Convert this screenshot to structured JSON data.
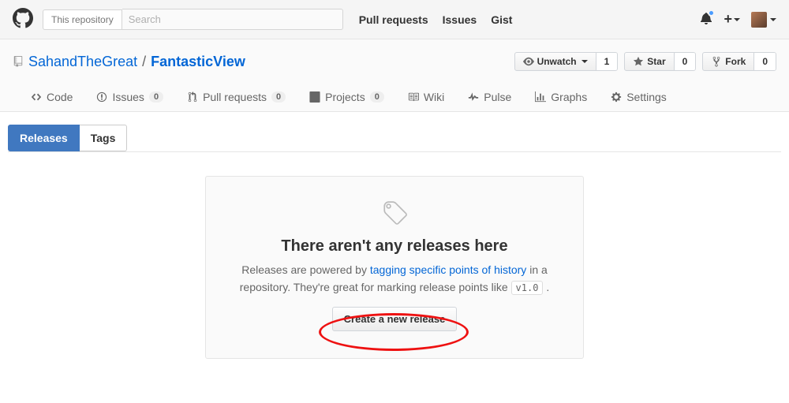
{
  "topbar": {
    "scope": "This repository",
    "search_placeholder": "Search",
    "nav": {
      "pulls": "Pull requests",
      "issues": "Issues",
      "gist": "Gist"
    }
  },
  "repo": {
    "owner": "SahandTheGreat",
    "sep": "/",
    "name": "FantasticView",
    "actions": {
      "watch": {
        "label": "Unwatch",
        "count": "1"
      },
      "star": {
        "label": "Star",
        "count": "0"
      },
      "fork": {
        "label": "Fork",
        "count": "0"
      }
    }
  },
  "reponav": {
    "code": "Code",
    "issues": {
      "label": "Issues",
      "count": "0"
    },
    "pulls": {
      "label": "Pull requests",
      "count": "0"
    },
    "projects": {
      "label": "Projects",
      "count": "0"
    },
    "wiki": "Wiki",
    "pulse": "Pulse",
    "graphs": "Graphs",
    "settings": "Settings"
  },
  "subnav": {
    "releases": "Releases",
    "tags": "Tags"
  },
  "blankslate": {
    "heading": "There aren't any releases here",
    "pre": "Releases are powered by ",
    "link": "tagging specific points of history",
    "mid": " in a repository. They're great for marking release points like ",
    "code": "v1.0",
    "post": " .",
    "button": "Create a new release"
  }
}
